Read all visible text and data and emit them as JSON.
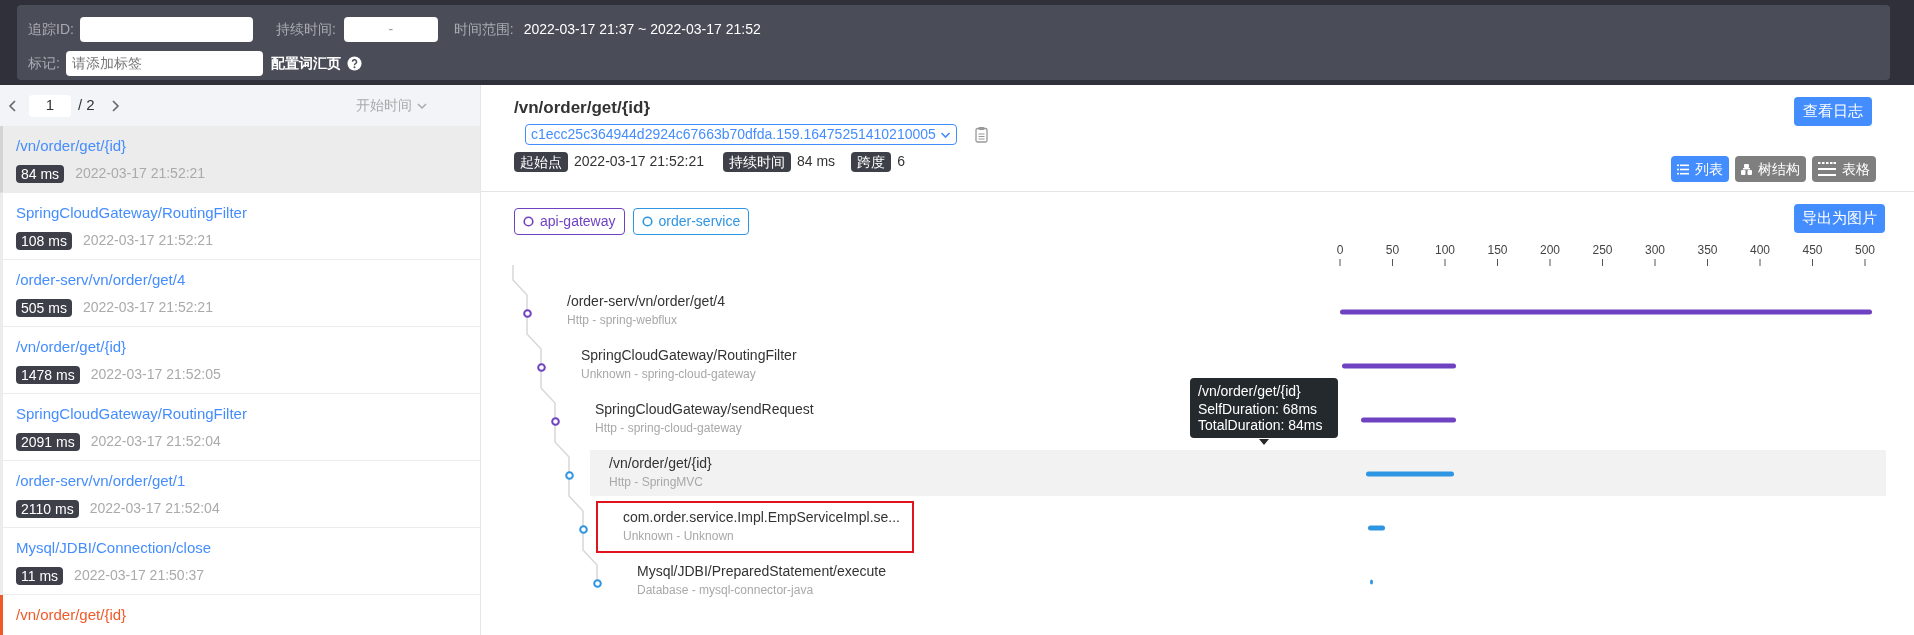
{
  "filters": {
    "trace_id_label": "追踪ID:",
    "duration_label": "持续时间:",
    "duration_value": "-",
    "time_range_label": "时间范围:",
    "time_range": "2022-03-17 21:37 ~ 2022-03-17 21:52",
    "tag_label": "标记:",
    "tag_placeholder": "请添加标签",
    "vocab_link": "配置词汇页"
  },
  "pagination": {
    "current": "1",
    "total": "/ 2",
    "sort": "开始时间"
  },
  "traces": [
    {
      "title": "/vn/order/get/{id}",
      "duration": "84 ms",
      "time": "2022-03-17 21:52:21",
      "selected": true,
      "error": false
    },
    {
      "title": "SpringCloudGateway/RoutingFilter",
      "duration": "108 ms",
      "time": "2022-03-17 21:52:21",
      "selected": false,
      "error": false
    },
    {
      "title": "/order-serv/vn/order/get/4",
      "duration": "505 ms",
      "time": "2022-03-17 21:52:21",
      "selected": false,
      "error": false
    },
    {
      "title": "/vn/order/get/{id}",
      "duration": "1478 ms",
      "time": "2022-03-17 21:52:05",
      "selected": false,
      "error": false
    },
    {
      "title": "SpringCloudGateway/RoutingFilter",
      "duration": "2091 ms",
      "time": "2022-03-17 21:52:04",
      "selected": false,
      "error": false
    },
    {
      "title": "/order-serv/vn/order/get/1",
      "duration": "2110 ms",
      "time": "2022-03-17 21:52:04",
      "selected": false,
      "error": false
    },
    {
      "title": "Mysql/JDBI/Connection/close",
      "duration": "11 ms",
      "time": "2022-03-17 21:50:37",
      "selected": false,
      "error": false
    },
    {
      "title": "/vn/order/get/{id}",
      "selected": false,
      "error": true
    }
  ],
  "detail": {
    "title": "/vn/order/get/{id}",
    "trace_id": "c1ecc25c364944d2924c67663b70dfda.159.16475251410210005",
    "start_label": "起始点",
    "start": "2022-03-17 21:52:21",
    "duration_label": "持续时间",
    "duration": "84 ms",
    "span_label": "跨度",
    "span_count": "6",
    "log_button": "查看日志",
    "views": [
      {
        "kind": "list",
        "label": "列表",
        "selected": true
      },
      {
        "kind": "tree",
        "label": "树结构",
        "selected": false
      },
      {
        "kind": "table",
        "label": "表格",
        "selected": false
      }
    ],
    "services": [
      {
        "name": "api-gateway",
        "color": "#6f42c1"
      },
      {
        "name": "order-service",
        "color": "#2e95e3"
      }
    ],
    "export_button": "导出为图片"
  },
  "spans": [
    {
      "title": "/order-serv/vn/order/get/4",
      "subtitle": "Http - spring-webflux",
      "color": "#6f42c1",
      "selected": false,
      "marked": false,
      "children": [
        {
          "title": "SpringCloudGateway/RoutingFilter",
          "subtitle": "Unknown - spring-cloud-gateway",
          "color": "#6f42c1",
          "selected": false,
          "marked": false,
          "children": [
            {
              "title": "SpringCloudGateway/sendRequest",
              "subtitle": "Http - spring-cloud-gateway",
              "color": "#6f42c1",
              "selected": false,
              "marked": false,
              "children": [
                {
                  "title": "/vn/order/get/{id}",
                  "subtitle": "Http - SpringMVC",
                  "color": "#2e95e3",
                  "selected": true,
                  "marked": false,
                  "children": [
                    {
                      "title": "com.order.service.Impl.EmpServiceImpl.se...",
                      "subtitle": "Unknown - Unknown",
                      "color": "#2e95e3",
                      "selected": false,
                      "marked": true,
                      "children": [
                        {
                          "title": "Mysql/JDBI/PreparedStatement/execute",
                          "subtitle": "Database - mysql-connector-java",
                          "color": "#2e95e3",
                          "selected": false,
                          "marked": false
                        }
                      ]
                    }
                  ]
                }
              ]
            }
          ]
        }
      ]
    }
  ],
  "tooltip": {
    "title": "/vn/order/get/{id}",
    "lines": [
      "SelfDuration: 68ms",
      "TotalDuration: 84ms"
    ]
  },
  "timeline": {
    "ticks": [
      "0",
      "50",
      "100",
      "150",
      "200",
      "250",
      "300",
      "350",
      "400",
      "450",
      "500"
    ]
  }
}
